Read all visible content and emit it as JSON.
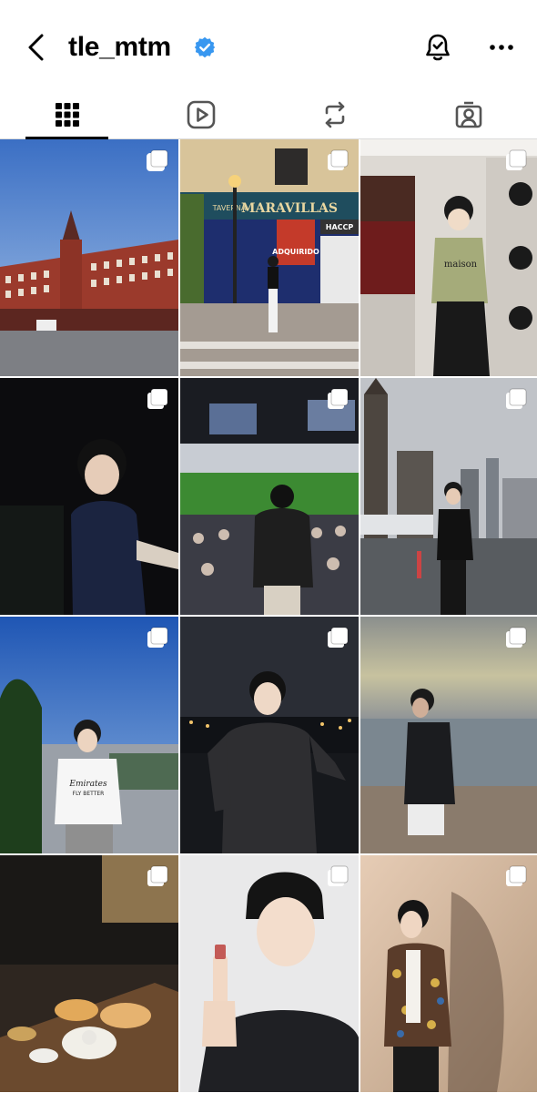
{
  "header": {
    "username": "tle_mtm",
    "verified": true,
    "icons": [
      "back-chevron-icon",
      "verified-badge-icon",
      "notification-bell-icon",
      "more-options-icon"
    ]
  },
  "tabs": [
    {
      "name": "posts-grid",
      "icon": "grid-icon",
      "active": true
    },
    {
      "name": "reels",
      "icon": "reels-play-icon",
      "active": false
    },
    {
      "name": "reposts",
      "icon": "repost-icon",
      "active": false
    },
    {
      "name": "tagged",
      "icon": "tagged-person-icon",
      "active": false
    }
  ],
  "posts": [
    {
      "scene": "plaza-building",
      "multi": true,
      "signs": []
    },
    {
      "scene": "street-shopfront",
      "multi": true,
      "signs": [
        "TAVERNA",
        "MARAVILLAS",
        "ADQUIRIDO",
        "HACCP"
      ]
    },
    {
      "scene": "speaker-booth",
      "multi": true,
      "signs": [
        "maison"
      ]
    },
    {
      "scene": "night-portrait",
      "multi": true,
      "signs": []
    },
    {
      "scene": "stadium",
      "multi": true,
      "signs": []
    },
    {
      "scene": "city-tower",
      "multi": true,
      "signs": []
    },
    {
      "scene": "rooftop-jersey",
      "multi": true,
      "signs": [
        "Emirates",
        "FLY BETTER"
      ]
    },
    {
      "scene": "night-city",
      "multi": true,
      "signs": []
    },
    {
      "scene": "beach-sunset",
      "multi": true,
      "signs": []
    },
    {
      "scene": "dinner-table",
      "multi": true,
      "signs": []
    },
    {
      "scene": "product-portrait",
      "multi": true,
      "signs": []
    },
    {
      "scene": "patterned-jacket",
      "multi": true,
      "signs": []
    }
  ],
  "colors": {
    "verified": "#3897f0",
    "divider": "#dbdbdb",
    "active_tab": "#000000"
  }
}
